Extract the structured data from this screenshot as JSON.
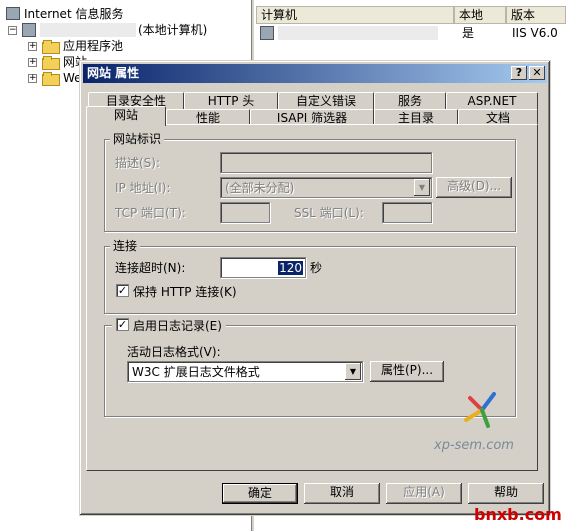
{
  "mmc": {
    "root_label": "Internet 信息服务",
    "computer_suffix": "(本地计算机)",
    "tree_items": [
      "应用程序池",
      "网站",
      "We"
    ],
    "list_columns": [
      "计算机",
      "本地",
      "版本"
    ],
    "list_row": {
      "local": "是",
      "version": "IIS V6.0"
    }
  },
  "dialog": {
    "title": "网站 属性",
    "help_btn": "?",
    "close_btn": "✕",
    "tabs_back": [
      "目录安全性",
      "HTTP 头",
      "自定义错误",
      "服务",
      "ASP.NET"
    ],
    "tabs_front": [
      "网站",
      "性能",
      "ISAPI 筛选器",
      "主目录",
      "文档"
    ],
    "active_tab": "网站",
    "identity": {
      "group_label": "网站标识",
      "desc_label": "描述(S):",
      "desc_value": "",
      "ip_label": "IP 地址(I):",
      "ip_value": "(全部未分配)",
      "advanced_btn": "高级(D)...",
      "tcp_label": "TCP 端口(T):",
      "tcp_value": "",
      "ssl_label": "SSL 端口(L):",
      "ssl_value": ""
    },
    "connection": {
      "group_label": "连接",
      "timeout_label": "连接超时(N):",
      "timeout_value": "120",
      "timeout_unit": "秒",
      "keepalive_label": "保持 HTTP 连接(K)",
      "keepalive_checked": true
    },
    "logging": {
      "enable_label": "启用日志记录(E)",
      "enable_checked": true,
      "format_label": "活动日志格式(V):",
      "format_value": "W3C 扩展日志文件格式",
      "properties_btn": "属性(P)..."
    },
    "buttons": {
      "ok": "确定",
      "cancel": "取消",
      "apply": "应用(A)",
      "help": "帮助"
    }
  },
  "watermark": {
    "text": "xp-sem.com",
    "brand": "bnxb.com"
  }
}
